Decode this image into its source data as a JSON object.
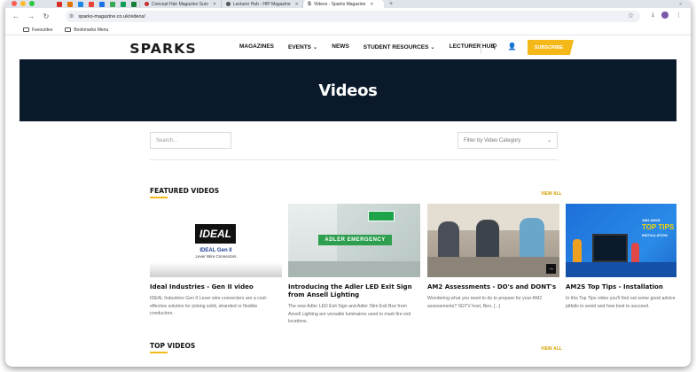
{
  "browser": {
    "tabs": [
      {
        "label": "Concept Hair Magazine Surv",
        "active": false
      },
      {
        "label": "Lecturer Hub - HIP Magazine",
        "active": false
      },
      {
        "label": "Videos - Sparks Magazine",
        "active": true
      }
    ],
    "url": "sparks-magazine.co.uk/videos/",
    "bookmarks": [
      "Favourites",
      "Bookmarks Menu"
    ],
    "pinned_tab_colors": [
      "#d93025",
      "#e37400",
      "#1e88e5",
      "#ea4335",
      "#1a73e8",
      "#34a853",
      "#0f9d58",
      "#188038"
    ]
  },
  "site": {
    "logo": "SPARKS",
    "nav": [
      "MAGAZINES",
      "EVENTS",
      "NEWS",
      "STUDENT RESOURCES",
      "LECTURER HUB"
    ],
    "subscribe_label": "SUBSCRIBE",
    "accent": "#f5b819",
    "hero_bg": "#0b1a2b"
  },
  "hero": {
    "title": "Videos"
  },
  "filters": {
    "search_placeholder": "Search...",
    "category_placeholder": "Filter by Video Category"
  },
  "featured": {
    "title": "FEATURED VIDEOS",
    "view_all": "VIEW ALL",
    "cards": [
      {
        "title": "Ideal Industries - Gen II video",
        "desc": "IDEAL Industries Gen II Lever wire connectors are a cost-effective solution for joining solid, stranded or flexible conductors.",
        "thumb_brand": "IDEAL",
        "thumb_caption1": "IDEAL Gen II",
        "thumb_caption2": "Lever Wire Connectors"
      },
      {
        "title": "Introducing the Adler LED Exit Sign from Ansell Lighting",
        "desc": "The new Adler LED Exit Sign and Adler Slim Exit Box from Ansell Lighting are versatile luminaires used to mark fire exit locations.",
        "thumb_sign": "ADLER EMERGENCY"
      },
      {
        "title": "AM2 Assessments - DO's and DONT's",
        "desc": "Wondering what you need to do to prepare for your AM2 assessments? SGTV host, Ben, [...]"
      },
      {
        "title": "AM2S Top Tips - Installation",
        "desc": "In this Top Tips video you'll find out some good advice on what pitfalls to avoid and how best to succeed.",
        "thumb_badge": "AM2 AM2S",
        "thumb_heading": "TOP TIPS",
        "thumb_sub": "INSTALLATION"
      }
    ]
  },
  "top_videos": {
    "title": "TOP VIDEOS",
    "view_all": "VIEW ALL"
  }
}
